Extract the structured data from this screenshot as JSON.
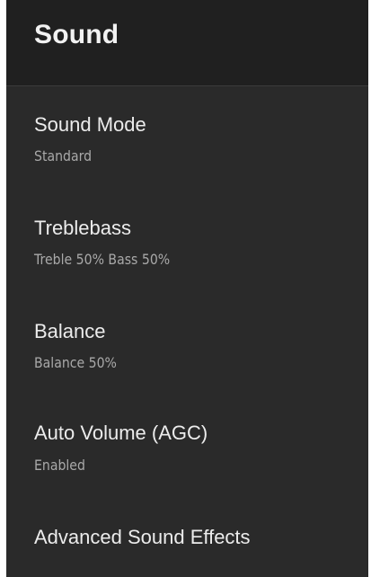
{
  "header": {
    "title": "Sound"
  },
  "menu": {
    "items": [
      {
        "label": "Sound Mode",
        "value": "Standard"
      },
      {
        "label": "Treblebass",
        "value": "Treble 50% Bass 50%"
      },
      {
        "label": "Balance",
        "value": "Balance 50%"
      },
      {
        "label": "Auto Volume (AGC)",
        "value": "Enabled"
      },
      {
        "label": "Advanced Sound Effects"
      }
    ]
  },
  "colors": {
    "background": "#2a2a2a",
    "header_background": "#202020",
    "title_text": "#f2f2f2",
    "primary_text": "#ececec",
    "secondary_text": "#a9a9a9"
  }
}
